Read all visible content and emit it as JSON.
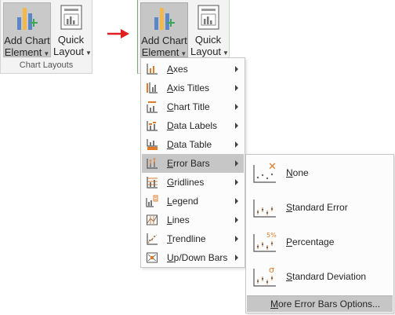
{
  "ribbon_left": {
    "add_chart_line1": "Add Chart",
    "add_chart_line2": "Element",
    "quick_line1": "Quick",
    "quick_line2": "Layout",
    "group_label": "Chart Layouts"
  },
  "ribbon_right": {
    "add_chart_line1": "Add Chart",
    "add_chart_line2": "Element",
    "quick_line1": "Quick",
    "quick_line2": "Layout"
  },
  "menu": {
    "items": [
      {
        "label": "Axes",
        "icon": "axes-icon"
      },
      {
        "label": "Axis Titles",
        "icon": "axis-titles-icon"
      },
      {
        "label": "Chart Title",
        "icon": "chart-title-icon"
      },
      {
        "label": "Data Labels",
        "icon": "data-labels-icon"
      },
      {
        "label": "Data Table",
        "icon": "data-table-icon"
      },
      {
        "label": "Error Bars",
        "icon": "error-bars-icon",
        "active": true
      },
      {
        "label": "Gridlines",
        "icon": "gridlines-icon"
      },
      {
        "label": "Legend",
        "icon": "legend-icon"
      },
      {
        "label": "Lines",
        "icon": "lines-icon"
      },
      {
        "label": "Trendline",
        "icon": "trendline-icon"
      },
      {
        "label": "Up/Down Bars",
        "icon": "up-down-bars-icon"
      }
    ]
  },
  "submenu": {
    "items": [
      {
        "label": "None",
        "icon": "error-bars-none-icon",
        "badge": "✕"
      },
      {
        "label": "Standard Error",
        "icon": "standard-error-icon",
        "badge": ""
      },
      {
        "label": "Percentage",
        "icon": "percentage-icon",
        "badge": "5%"
      },
      {
        "label": "Standard Deviation",
        "icon": "standard-deviation-icon",
        "badge": "σ"
      }
    ],
    "more_options": "More Error Bars Options..."
  },
  "colors": {
    "accent_orange": "#e07b29",
    "pressed_gray": "#c6c6c6",
    "arrow_red": "#e02020"
  }
}
